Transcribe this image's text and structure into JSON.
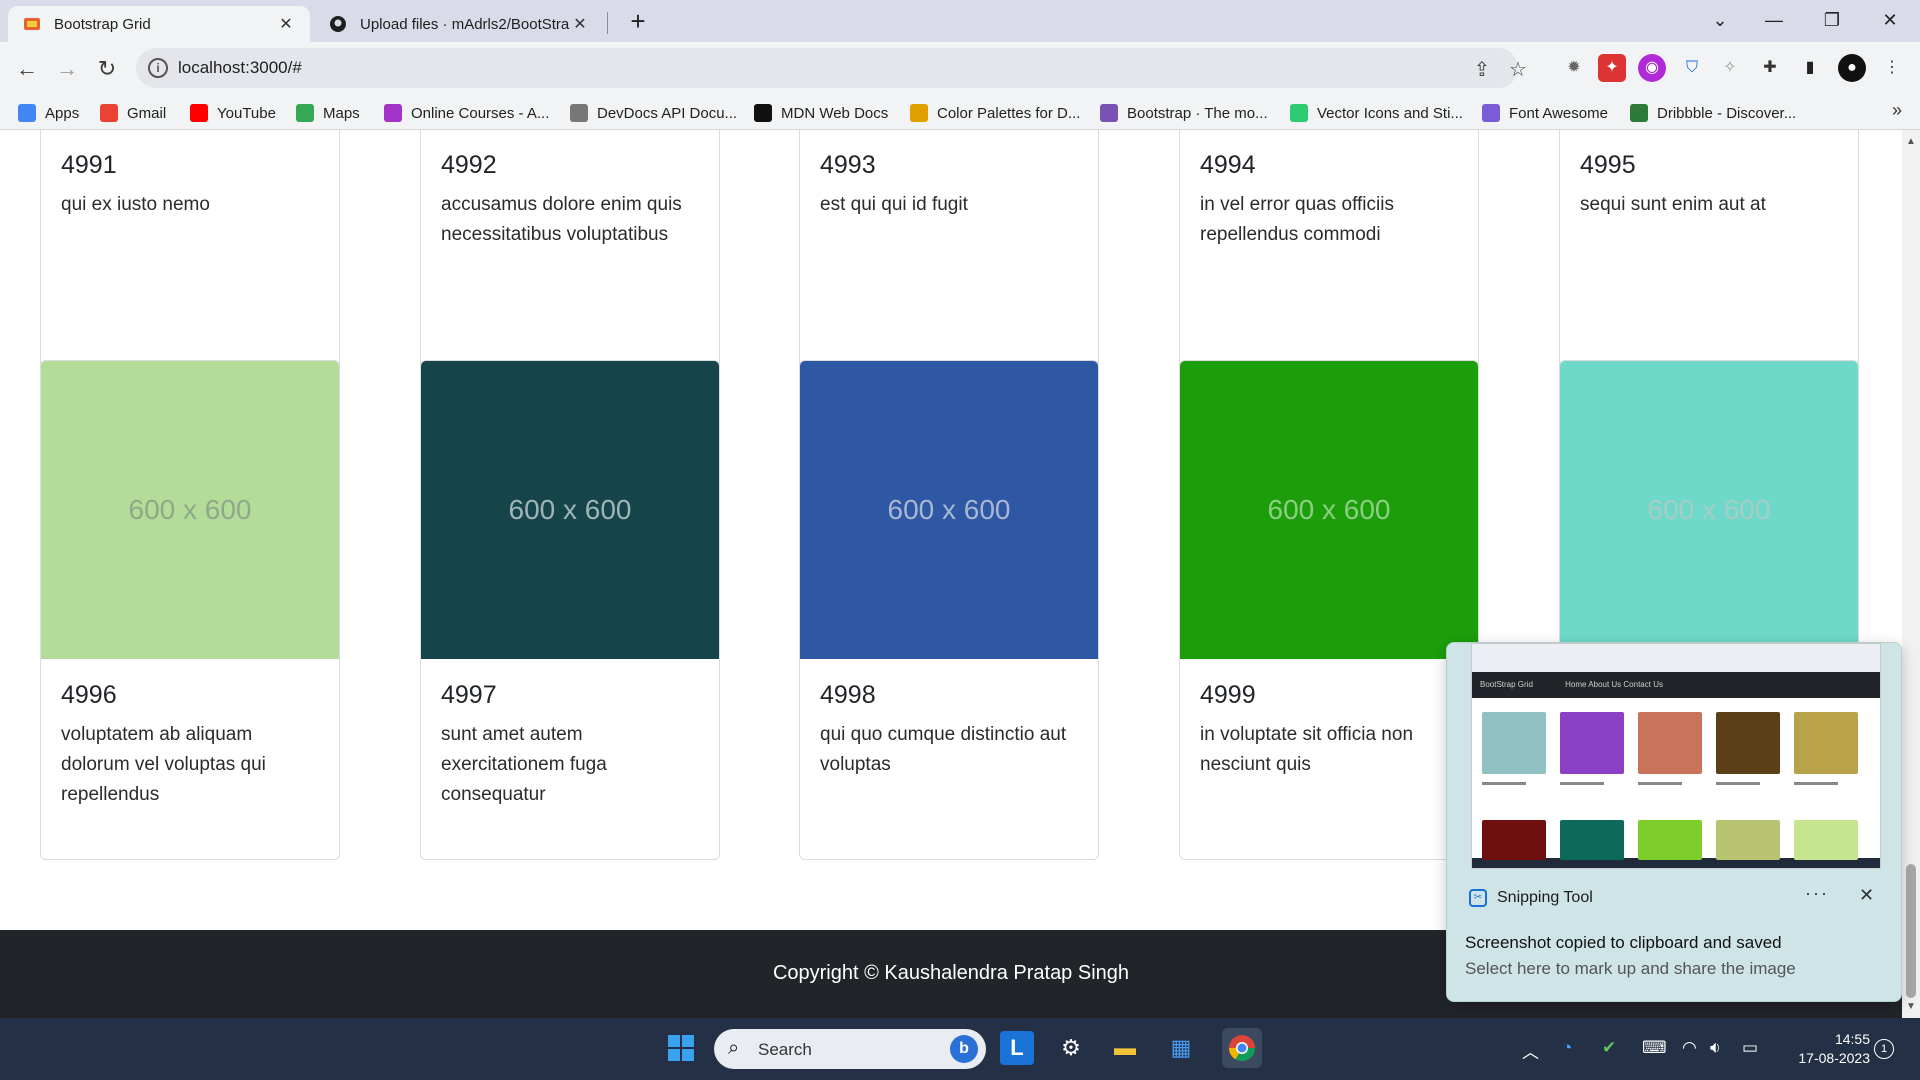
{
  "browser": {
    "tabs": [
      {
        "title": "Bootstrap Grid",
        "active": true
      },
      {
        "title": "Upload files · mAdrls2/BootStrap",
        "active": false
      }
    ],
    "url": "localhost:3000/#",
    "bookmarks": [
      {
        "label": "Apps",
        "icon": "apps-grid-icon",
        "color": "#4285f4"
      },
      {
        "label": "Gmail",
        "icon": "gmail-icon",
        "color": "#ea4335"
      },
      {
        "label": "YouTube",
        "icon": "youtube-icon",
        "color": "#ff0000"
      },
      {
        "label": "Maps",
        "icon": "maps-pin-icon",
        "color": "#34a853"
      },
      {
        "label": "Online Courses - A...",
        "icon": "courses-icon",
        "color": "#a333c8"
      },
      {
        "label": "DevDocs API Docu...",
        "icon": "devdocs-icon",
        "color": "#777777"
      },
      {
        "label": "MDN Web Docs",
        "icon": "mdn-icon",
        "color": "#111111"
      },
      {
        "label": "Color Palettes for D...",
        "icon": "palette-icon",
        "color": "#e0a100"
      },
      {
        "label": "Bootstrap · The mo...",
        "icon": "bootstrap-icon",
        "color": "#7952b3"
      },
      {
        "label": "Vector Icons and Sti...",
        "icon": "flaticon-icon",
        "color": "#2ecc71"
      },
      {
        "label": "Font Awesome",
        "icon": "font-awesome-icon",
        "color": "#7c5cd6"
      },
      {
        "label": "Dribbble - Discover...",
        "icon": "dribbble-icon",
        "color": "#2d7a3a"
      }
    ]
  },
  "cards_row1": [
    {
      "id": "4991",
      "text": "qui ex iusto nemo",
      "accent": "#2f5aa8"
    },
    {
      "id": "4992",
      "text": "accusamus dolore enim quis necessitatibus voluptatibus",
      "accent": "#d6237a"
    },
    {
      "id": "4993",
      "text": "est qui qui id fugit",
      "accent": "#c9542a"
    },
    {
      "id": "4994",
      "text": "in vel error quas officiis repellendus commodi",
      "accent": "#7ee36a"
    },
    {
      "id": "4995",
      "text": "sequi sunt enim aut at",
      "accent": "#0f4f22"
    }
  ],
  "cards_row2": [
    {
      "id": "4996",
      "text": "voluptatem ab aliquam dolorum vel voluptas qui repellendus",
      "image_label": "600 x 600",
      "color": "#b4dc99",
      "label_color": "#8fa88a"
    },
    {
      "id": "4997",
      "text": "sunt amet autem exercitationem fuga consequatur",
      "image_label": "600 x 600",
      "color": "#15454a",
      "label_color": "#9fb4b6"
    },
    {
      "id": "4998",
      "text": "qui quo cumque distinctio aut voluptas",
      "image_label": "600 x 600",
      "color": "#2e57a4",
      "label_color": "#a8b7d2"
    },
    {
      "id": "4999",
      "text": "in voluptate sit officia non nesciunt quis",
      "image_label": "600 x 600",
      "color": "#1c9e0a",
      "label_color": "#8ccf82"
    },
    {
      "id": "",
      "text": "",
      "image_label": "600 x 600",
      "color": "#6fd9c9",
      "label_color": "#a7cdc6"
    }
  ],
  "footer": {
    "copyright": "Copyright © Kaushalendra Pratap Singh"
  },
  "toast": {
    "app_name": "Snipping Tool",
    "more": "···",
    "close": "✕",
    "line1": "Screenshot copied to clipboard and saved",
    "line2": "Select here to mark up and share the image",
    "preview": {
      "brand": "BootStrap Grid",
      "nav": "Home  About Us  Contact Us",
      "colors_row1": [
        "#8fc1c2",
        "#8a3fc4",
        "#c9735b",
        "#5a3f19",
        "#b8a24a"
      ],
      "colors_row2": [
        "#6e1010",
        "#0e6a58",
        "#7dce2a",
        "#b9c473",
        "#c5e58e"
      ]
    }
  },
  "taskbar": {
    "search_label": "Search",
    "time": "14:55",
    "date": "17-08-2023",
    "notification_count": "1"
  }
}
